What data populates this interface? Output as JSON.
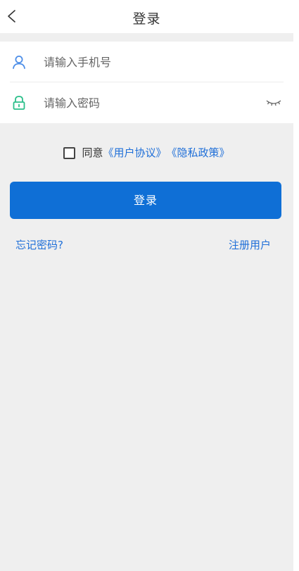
{
  "header": {
    "title": "登录"
  },
  "form": {
    "phone_placeholder": "请输入手机号",
    "password_placeholder": "请输入密码"
  },
  "agreement": {
    "prefix": "同意",
    "user_agreement": "《用户协议》",
    "privacy_policy": "《隐私政策》"
  },
  "actions": {
    "login_label": "登录",
    "forgot_label": "忘记密码?",
    "register_label": "注册用户"
  },
  "colors": {
    "accent": "#0f6fd6",
    "link": "#1f6fd8",
    "user_icon": "#4d8ee8",
    "lock_icon": "#2bbf8a",
    "background": "#efefef"
  },
  "icons": {
    "back": "chevron-left-icon",
    "user": "user-icon",
    "lock": "lock-icon",
    "eye": "eye-closed-icon"
  }
}
